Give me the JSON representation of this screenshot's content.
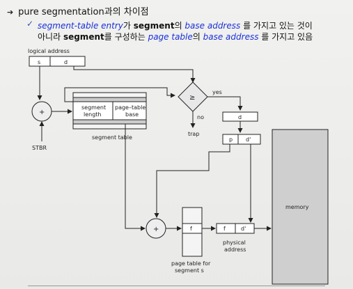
{
  "heading": "pure segmentation과의 차이점",
  "sub1": {
    "part1": "segment-table entry",
    "part2": "가 ",
    "part3": "segment",
    "part4": "의 ",
    "part5": "base address",
    "part6": " 를 가지고 있는 것이"
  },
  "sub2": {
    "part1": "아니라 ",
    "part2": "segment",
    "part3": "를 구성하는 ",
    "part4": "page table",
    "part5": "의 ",
    "part6": "base address",
    "part7": " 를 가지고 있음"
  },
  "diagram": {
    "logical_address": "logical address",
    "s": "s",
    "d": "d",
    "plus": "+",
    "stbr": "STBR",
    "seg_length_1": "segment",
    "seg_length_2": "length",
    "pt_base_1": "page–table",
    "pt_base_2": "base",
    "segment_table": "segment table",
    "compare": "≥",
    "yes": "yes",
    "no": "no",
    "trap": "trap",
    "d2": "d",
    "p": "p",
    "dprime": "d'",
    "memory": "memory",
    "f": "f",
    "f2": "f",
    "dprime2": "d'",
    "physical_1": "physical",
    "physical_2": "address",
    "ptfor_1": "page table for",
    "ptfor_2": "segment s"
  }
}
